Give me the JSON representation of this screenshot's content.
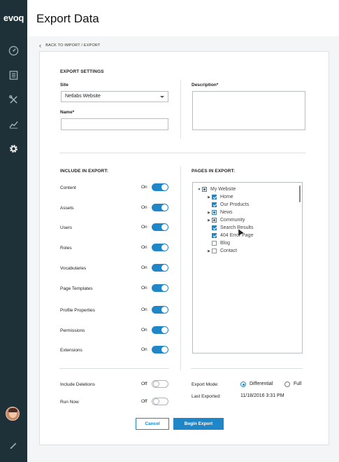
{
  "app": {
    "logo": "evoq"
  },
  "sidebar": {
    "items": [
      {
        "name": "dashboard",
        "icon": "gauge-icon"
      },
      {
        "name": "content",
        "icon": "document-icon"
      },
      {
        "name": "tools",
        "icon": "tools-icon"
      },
      {
        "name": "analytics",
        "icon": "chart-icon"
      },
      {
        "name": "settings",
        "icon": "gear-icon"
      }
    ],
    "bottom_icon": "pencil-icon"
  },
  "header": {
    "title": "Export Data"
  },
  "breadcrumb": {
    "back_label": "BACK TO IMPORT / EXPORT"
  },
  "export_settings": {
    "section_title": "EXPORT SETTINGS",
    "site_label": "Site",
    "site_value": "Netlabs Website",
    "name_label": "Name*",
    "name_value": "",
    "description_label": "Description*",
    "description_value": ""
  },
  "include": {
    "title": "INCLUDE IN EXPORT:",
    "items": [
      {
        "label": "Content",
        "state": "On"
      },
      {
        "label": "Assets",
        "state": "On"
      },
      {
        "label": "Users",
        "state": "On"
      },
      {
        "label": "Roles",
        "state": "On"
      },
      {
        "label": "Vocabularies",
        "state": "On"
      },
      {
        "label": "Page Templates",
        "state": "On"
      },
      {
        "label": "Profile Properties",
        "state": "On"
      },
      {
        "label": "Permissions",
        "state": "On"
      },
      {
        "label": "Extensions",
        "state": "On"
      }
    ],
    "options": [
      {
        "label": "Include Deletions",
        "state": "Off"
      },
      {
        "label": "Run Now",
        "state": "Off"
      }
    ]
  },
  "pages": {
    "title": "PAGES IN EXPORT:",
    "tree": [
      {
        "label": "My Website",
        "level": 0,
        "expander": "down",
        "check": "partial"
      },
      {
        "label": "Home",
        "level": 1,
        "expander": "right",
        "check": "checked"
      },
      {
        "label": "Our Products",
        "level": 1,
        "expander": "",
        "check": "checked"
      },
      {
        "label": "News",
        "level": 1,
        "expander": "right",
        "check": "partial"
      },
      {
        "label": "Community",
        "level": 1,
        "expander": "right",
        "check": "partial"
      },
      {
        "label": "Search Results",
        "level": 1,
        "expander": "",
        "check": "checked"
      },
      {
        "label": "404 Error Page",
        "level": 1,
        "expander": "",
        "check": "checked"
      },
      {
        "label": "Blog",
        "level": 1,
        "expander": "",
        "check": "none"
      },
      {
        "label": "Contact",
        "level": 1,
        "expander": "right",
        "check": "none"
      }
    ]
  },
  "export_mode": {
    "label": "Export Mode:",
    "options": [
      {
        "label": "Differential",
        "selected": true
      },
      {
        "label": "Full",
        "selected": false
      }
    ],
    "last_exported_label": "Last Exported:",
    "last_exported_value": "11/18/2016 3:31 PM"
  },
  "actions": {
    "cancel": "Cancel",
    "begin": "Begin Export"
  },
  "colors": {
    "accent": "#1f86c8",
    "sidebar": "#1e3138"
  }
}
